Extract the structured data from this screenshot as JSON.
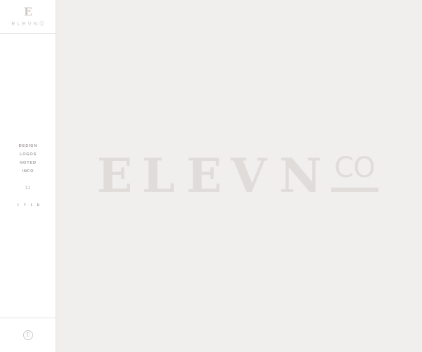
{
  "brand": {
    "mark": "E",
    "wordmark": "ELEVNⒸ"
  },
  "nav": {
    "items": [
      {
        "label": "DESIGN"
      },
      {
        "label": "LOGOS"
      },
      {
        "label": "NOTED"
      },
      {
        "label": "INFO"
      }
    ]
  },
  "tiny_mark": "11",
  "social": [
    {
      "glyph": "i",
      "icon": "instagram-icon"
    },
    {
      "glyph": "f",
      "icon": "facebook-icon"
    },
    {
      "glyph": "t",
      "icon": "twitter-icon"
    },
    {
      "glyph": "b",
      "icon": "behance-icon"
    }
  ],
  "footer": {
    "badge": "E"
  },
  "hero": {
    "letters": [
      "E",
      "L",
      "E",
      "V",
      "N"
    ],
    "co": "CO"
  },
  "colors": {
    "background": "#f0efee",
    "sidebar": "#ffffff",
    "logo": "#e0dcd9",
    "nav_text": "#9f9995"
  }
}
